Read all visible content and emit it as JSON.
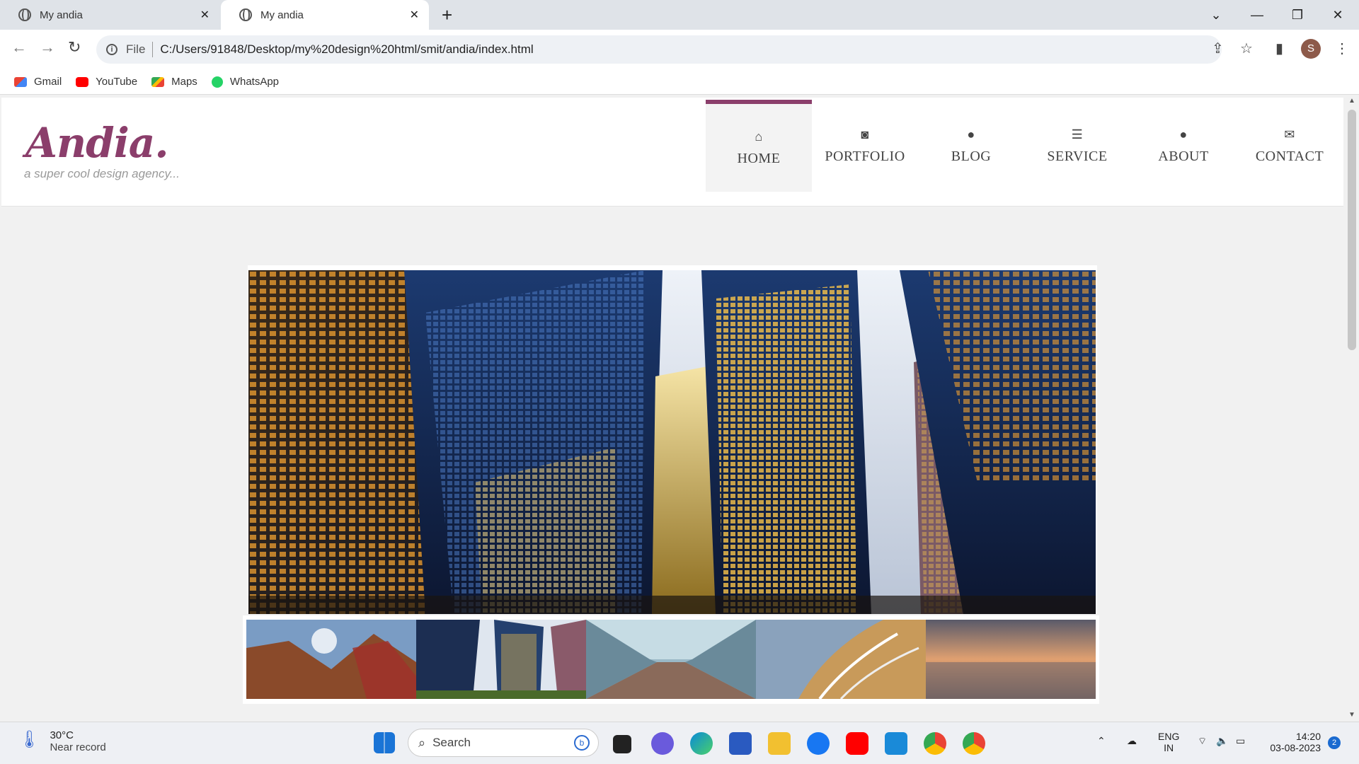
{
  "browser": {
    "tabs": [
      {
        "title": "My andia"
      },
      {
        "title": "My andia"
      }
    ],
    "new_tab": "+",
    "url_prefix": "File",
    "url": "C:/Users/91848/Desktop/my%20design%20html/smit/andia/index.html",
    "profile_initial": "S",
    "bookmarks": [
      {
        "label": "Gmail",
        "icon": "gmail-icon",
        "color": "#ea4335"
      },
      {
        "label": "YouTube",
        "icon": "youtube-icon",
        "color": "#ff0000"
      },
      {
        "label": "Maps",
        "icon": "maps-icon",
        "color": "#34a853"
      },
      {
        "label": "WhatsApp",
        "icon": "whatsapp-icon",
        "color": "#25d366"
      }
    ]
  },
  "site": {
    "logo": "Andia.",
    "tagline": "a super cool design agency...",
    "accent": "#8b3e6b",
    "menu": [
      {
        "label": "HOME",
        "icon": "home-icon",
        "glyph": "⌂"
      },
      {
        "label": "PORTFOLIO",
        "icon": "camera-icon",
        "glyph": "◙"
      },
      {
        "label": "BLOG",
        "icon": "comment-icon",
        "glyph": "●"
      },
      {
        "label": "SERVICE",
        "icon": "server-icon",
        "glyph": "☰"
      },
      {
        "label": "ABOUT",
        "icon": "user-icon",
        "glyph": "●"
      },
      {
        "label": "CONTACT",
        "icon": "envelope-icon",
        "glyph": "✉"
      }
    ],
    "active_menu": "HOME"
  },
  "taskbar": {
    "weather_temp": "30°C",
    "weather_desc": "Near record",
    "search_placeholder": "Search",
    "lang1": "ENG",
    "lang2": "IN",
    "time": "14:20",
    "date": "03-08-2023",
    "notification_count": "2"
  }
}
